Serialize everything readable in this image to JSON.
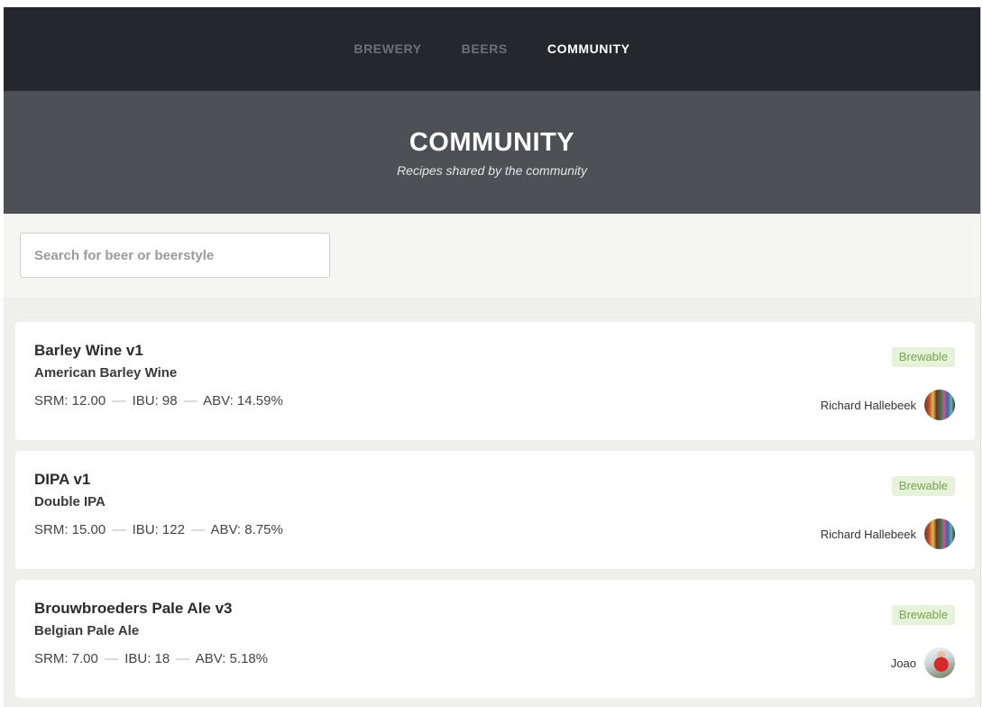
{
  "nav": {
    "items": [
      {
        "label": "BREWERY",
        "active": false
      },
      {
        "label": "BEERS",
        "active": false
      },
      {
        "label": "COMMUNITY",
        "active": true
      }
    ]
  },
  "hero": {
    "title": "COMMUNITY",
    "subtitle": "Recipes shared by the community"
  },
  "search": {
    "placeholder": "Search for beer or beerstyle",
    "value": ""
  },
  "recipes": [
    {
      "name": "Barley Wine v1",
      "style": "American Barley Wine",
      "srm": "SRM: 12.00",
      "ibu": "IBU: 98",
      "abv": "ABV: 14.59%",
      "badge": "Brewable",
      "author": "Richard Hallebeek",
      "avatar_icon": "bottles-avatar"
    },
    {
      "name": "DIPA v1",
      "style": "Double IPA",
      "srm": "SRM: 15.00",
      "ibu": "IBU: 122",
      "abv": "ABV: 8.75%",
      "badge": "Brewable",
      "author": "Richard Hallebeek",
      "avatar_icon": "bottles-avatar"
    },
    {
      "name": "Brouwbroeders Pale Ale v3",
      "style": "Belgian Pale Ale",
      "srm": "SRM: 7.00",
      "ibu": "IBU: 18",
      "abv": "ABV: 5.18%",
      "badge": "Brewable",
      "author": "Joao",
      "avatar_icon": "person-avatar"
    }
  ],
  "separator": "—",
  "colors": {
    "nav_bg": "#24272b",
    "hero_bg": "#4f5056",
    "badge_bg": "#e6f2da",
    "badge_text": "#74a550"
  }
}
